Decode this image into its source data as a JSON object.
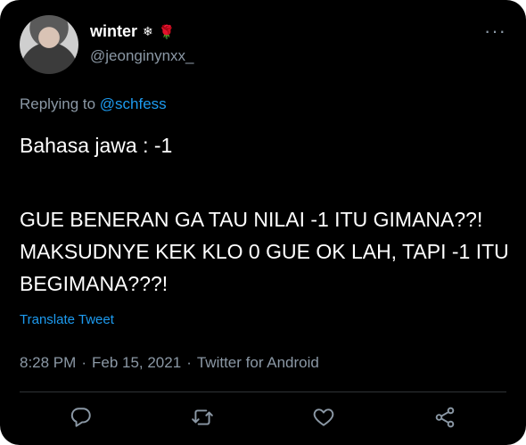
{
  "user": {
    "display_name": "winter",
    "emoji_1": "❄",
    "emoji_2": "🌹",
    "handle": "@jeonginynxx_"
  },
  "more_label": "···",
  "replying": {
    "prefix": "Replying to ",
    "mention": "@schfess"
  },
  "tweet": {
    "line1": "Bahasa jawa : -1",
    "body": "GUE BENERAN GA TAU NILAI -1 ITU GIMANA??! MAKSUDNYE KEK KLO 0 GUE OK LAH, TAPI -1 ITU BEGIMANA???!"
  },
  "translate_label": "Translate Tweet",
  "meta": {
    "time": "8:28 PM",
    "date": "Feb 15, 2021",
    "source": "Twitter for Android",
    "separator": "·"
  },
  "icons": {
    "reply": "reply-icon",
    "retweet": "retweet-icon",
    "like": "like-icon",
    "share": "share-icon"
  }
}
